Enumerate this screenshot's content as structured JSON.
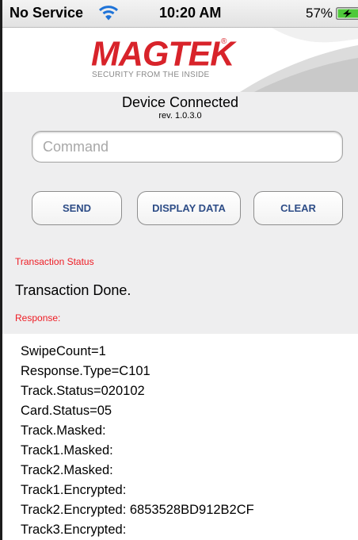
{
  "status_bar": {
    "carrier": "No Service",
    "time": "10:20 AM",
    "battery_percent": "57%"
  },
  "header": {
    "brand": "MAGTEK",
    "registered_mark": "®",
    "tagline": "SECURITY FROM THE INSIDE"
  },
  "device": {
    "status": "Device Connected",
    "revision": "rev. 1.0.3.0"
  },
  "command_field": {
    "placeholder": "Command",
    "value": ""
  },
  "buttons": {
    "send": "SEND",
    "display_data": "DISPLAY DATA",
    "clear": "CLEAR"
  },
  "transaction": {
    "status_label": "Transaction Status",
    "status_value": "Transaction Done.",
    "response_label": "Response:"
  },
  "response_lines": [
    "SwipeCount=1",
    "Response.Type=C101",
    "Track.Status=020102",
    "Card.Status=05",
    "Track.Masked:",
    "Track1.Masked:",
    "Track2.Masked:",
    "Track1.Encrypted:",
    "Track2.Encrypted: 6853528BD912B2CF",
    "Track3.Encrypted:"
  ],
  "colors": {
    "brand_red": "#d8232a",
    "label_red": "#ee1c24",
    "button_text": "#2e4d87",
    "panel_bg": "#eeeeef",
    "battery_green": "#4fc93a"
  },
  "icons": [
    "wifi-icon",
    "battery-charging-icon"
  ]
}
